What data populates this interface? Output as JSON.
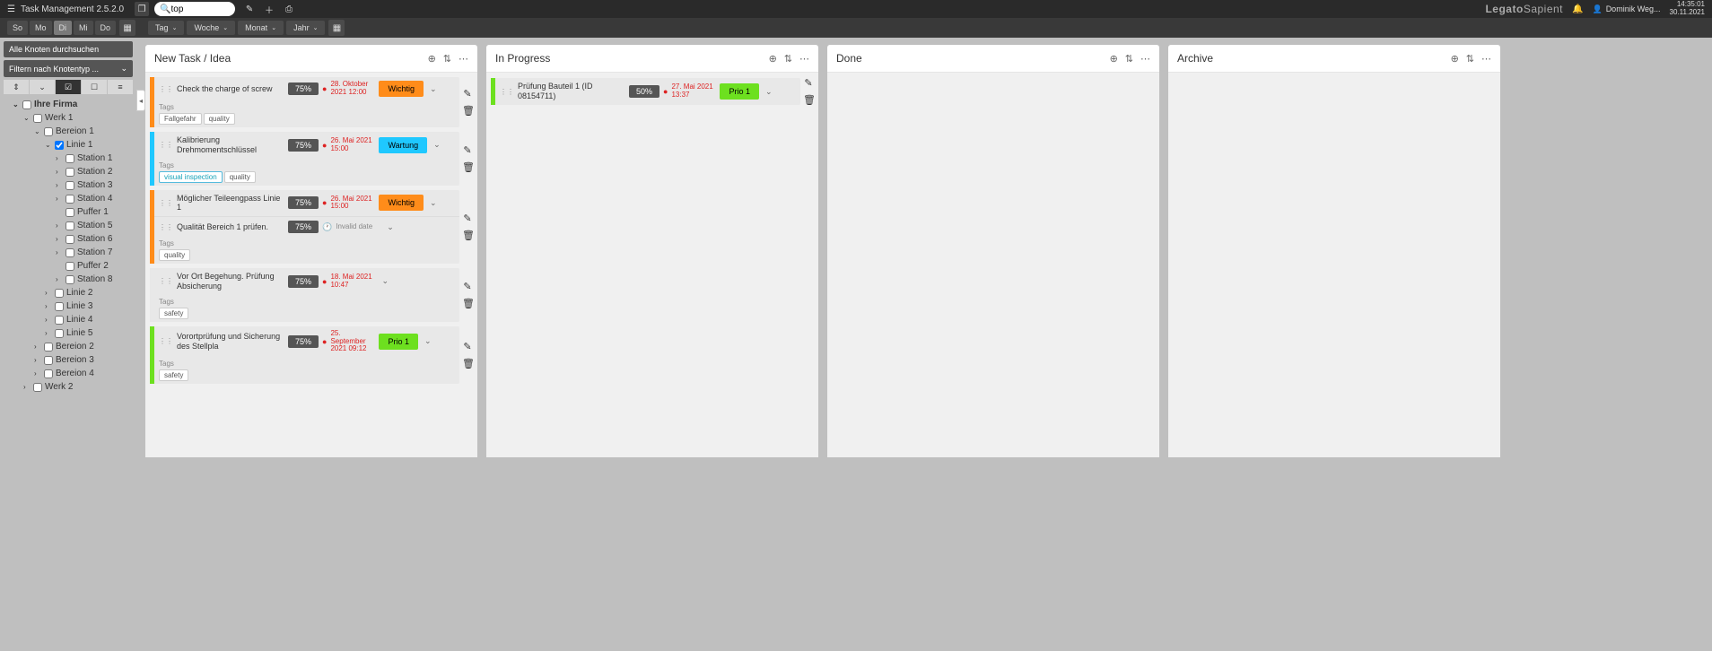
{
  "app": {
    "title": "Task Management 2.5.2.0"
  },
  "search": {
    "value": "top"
  },
  "brand": {
    "logo1": "Legato",
    "logo2": "Sapient"
  },
  "user": {
    "name": "Dominik Weg...",
    "time": "14:35:01",
    "date": "30.11.2021"
  },
  "weekdays": [
    {
      "l": "So"
    },
    {
      "l": "Mo"
    },
    {
      "l": "Di",
      "active": true
    },
    {
      "l": "Mi"
    },
    {
      "l": "Do"
    }
  ],
  "timeframes": [
    {
      "l": "Tag"
    },
    {
      "l": "Woche"
    },
    {
      "l": "Monat"
    },
    {
      "l": "Jahr"
    }
  ],
  "sidebar": {
    "search": "Alle Knoten durchsuchen",
    "filter": "Filtern nach Knotentyp ...",
    "tree": [
      {
        "l": "Ihre Firma",
        "lvl": 1,
        "car": "v",
        "bold": true,
        "chk": false
      },
      {
        "l": "Werk 1",
        "lvl": 2,
        "car": "v",
        "chk": false
      },
      {
        "l": "Bereion 1",
        "lvl": 3,
        "car": "v",
        "chk": false
      },
      {
        "l": "Linie 1",
        "lvl": 4,
        "car": "v",
        "chk": true
      },
      {
        "l": "Station 1",
        "lvl": 5,
        "car": ">",
        "chk": false
      },
      {
        "l": "Station 2",
        "lvl": 5,
        "car": ">",
        "chk": false
      },
      {
        "l": "Station 3",
        "lvl": 5,
        "car": ">",
        "chk": false
      },
      {
        "l": "Station 4",
        "lvl": 5,
        "car": ">",
        "chk": false
      },
      {
        "l": "Puffer 1",
        "lvl": 5,
        "car": "",
        "chk": false
      },
      {
        "l": "Station 5",
        "lvl": 5,
        "car": ">",
        "chk": false
      },
      {
        "l": "Station 6",
        "lvl": 5,
        "car": ">",
        "chk": false
      },
      {
        "l": "Station 7",
        "lvl": 5,
        "car": ">",
        "chk": false
      },
      {
        "l": "Puffer 2",
        "lvl": 5,
        "car": "",
        "chk": false
      },
      {
        "l": "Station 8",
        "lvl": 5,
        "car": ">",
        "chk": false
      },
      {
        "l": "Linie 2",
        "lvl": 4,
        "car": ">",
        "chk": false
      },
      {
        "l": "Linie 3",
        "lvl": 4,
        "car": ">",
        "chk": false
      },
      {
        "l": "Linie 4",
        "lvl": 4,
        "car": ">",
        "chk": false
      },
      {
        "l": "Linie 5",
        "lvl": 4,
        "car": ">",
        "chk": false
      },
      {
        "l": "Bereion 2",
        "lvl": 3,
        "car": ">",
        "chk": false
      },
      {
        "l": "Bereion 3",
        "lvl": 3,
        "car": ">",
        "chk": false
      },
      {
        "l": "Bereion 4",
        "lvl": 3,
        "car": ">",
        "chk": false
      },
      {
        "l": "Werk 2",
        "lvl": 2,
        "car": ">",
        "chk": false
      }
    ]
  },
  "columns": [
    {
      "title": "New Task / Idea",
      "cards": [
        {
          "title": "Check the charge of screw",
          "pct": "75%",
          "date": "28. Oktober 2021 12:00",
          "prio": "Wichtig",
          "prioColor": "#ff8c1a",
          "bar": "#ff8c1a",
          "tags": [
            "Fallgefahr",
            "quality"
          ]
        },
        {
          "title": "Kalibrierung Drehmomentschlüssel",
          "pct": "75%",
          "date": "26. Mai 2021 15:00",
          "prio": "Wartung",
          "prioColor": "#1fc8ff",
          "bar": "#1fc8ff",
          "tags": [
            "visual inspection",
            "quality"
          ],
          "tagBlue": true
        },
        {
          "title": "Möglicher Teileengpass Linie 1",
          "pct": "75%",
          "date": "26. Mai 2021 15:00",
          "prio": "Wichtig",
          "prioColor": "#ff8c1a",
          "bar": "#ff8c1a"
        },
        {
          "title": "Qualität Bereich 1 prüfen.",
          "pct": "75%",
          "date": "Invalid date",
          "dateGray": true,
          "bar": "#e8e8e8",
          "noPrio": true,
          "tags": [
            "quality"
          ],
          "merge": true
        },
        {
          "title": "Vor Ort Begehung. Prüfung Absicherung",
          "pct": "75%",
          "date": "18. Mai 2021 10:47",
          "bar": "#e8e8e8",
          "noPrio": true,
          "tags": [
            "safety"
          ]
        },
        {
          "title": "Vorortprüfung und Sicherung des Stellpla",
          "pct": "75%",
          "date": "25. September 2021 09:12",
          "prio": "Prio 1",
          "prioColor": "#6de01f",
          "bar": "#6de01f",
          "tags": [
            "safety"
          ]
        }
      ]
    },
    {
      "title": "In Progress",
      "cards": [
        {
          "title": "Prüfung Bauteil 1 (ID 08154711)",
          "pct": "50%",
          "date": "27. Mai 2021 13:37",
          "prio": "Prio 1",
          "prioColor": "#6de01f",
          "bar": "#6de01f"
        }
      ]
    },
    {
      "title": "Done",
      "cards": []
    },
    {
      "title": "Archive",
      "cards": []
    }
  ],
  "labels": {
    "tags": "Tags"
  }
}
